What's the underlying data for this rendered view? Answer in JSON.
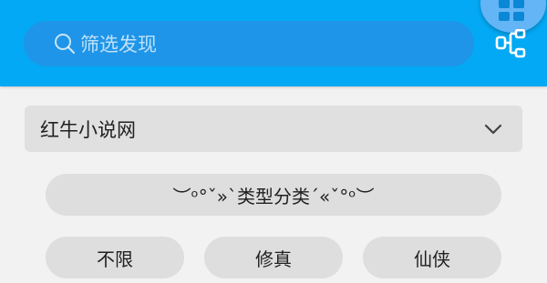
{
  "search": {
    "placeholder": "筛选发现",
    "icon": "search-icon"
  },
  "toolbar": {
    "menu_icon": "grid-icon",
    "filter_icon": "tree-filter-icon"
  },
  "source_select": {
    "value": "红牛小说网",
    "icon": "chevron-down-icon"
  },
  "category_header": {
    "label": "︶ᵒ°ˇ»ˋ类型分类ˊ«ˇ°ᵒ︶"
  },
  "categories": [
    {
      "label": "不限"
    },
    {
      "label": "修真"
    },
    {
      "label": "仙侠"
    }
  ],
  "colors": {
    "primary": "#03a9f4",
    "search_bg": "#1e95e8",
    "fab": "#64b5f6",
    "chip_bg": "#dedede",
    "page_bg": "#f2f2f2"
  }
}
